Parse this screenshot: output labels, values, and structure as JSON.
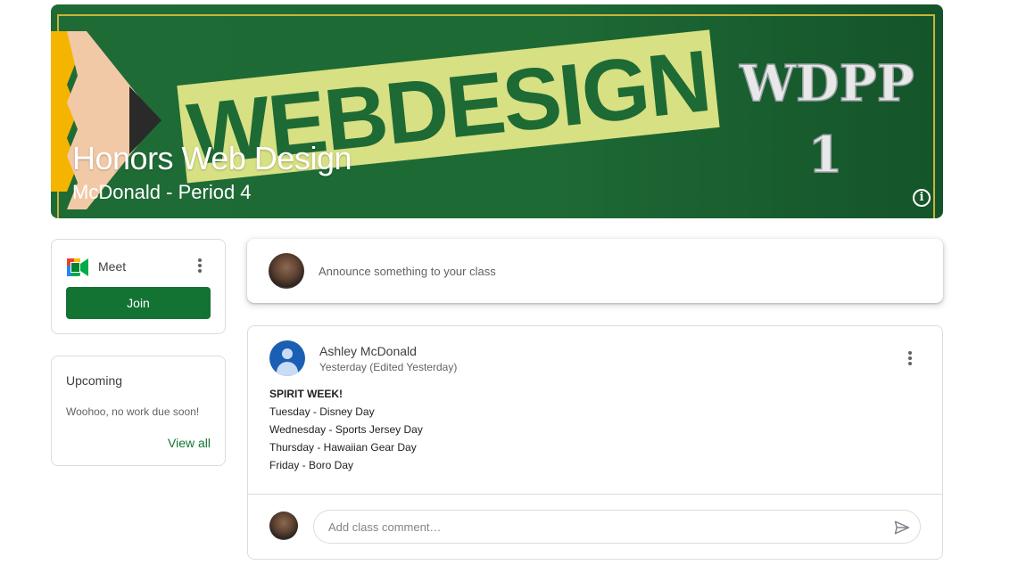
{
  "banner": {
    "title": "Honors Web Design",
    "subtitle": "McDonald - Period 4",
    "art_text_main": "WEBDESIGN",
    "art_text_code": "WDPP",
    "art_text_number": "1"
  },
  "meet": {
    "label": "Meet",
    "join_label": "Join"
  },
  "upcoming": {
    "title": "Upcoming",
    "message": "Woohoo, no work due soon!",
    "view_all_label": "View all"
  },
  "announce": {
    "placeholder": "Announce something to your class"
  },
  "post": {
    "author": "Ashley McDonald",
    "time": "Yesterday (Edited Yesterday)",
    "lines": [
      "SPIRIT WEEK!",
      "Tuesday - Disney Day",
      "Wednesday - Sports Jersey Day",
      "Thursday - Hawaiian Gear Day",
      "Friday - Boro Day"
    ],
    "comment_placeholder": "Add class comment…"
  },
  "colors": {
    "accent_green": "#137333",
    "banner_green": "#1e6a35"
  },
  "icons": {
    "banner_info": "info-icon",
    "meet_logo": "google-meet-icon",
    "more": "more-vert-icon",
    "send": "send-icon",
    "avatar_default": "default-avatar-icon"
  }
}
